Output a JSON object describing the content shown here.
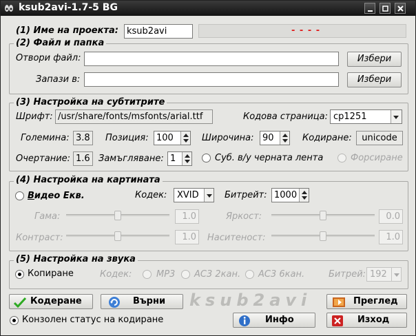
{
  "window": {
    "title": "ksub2avi-1.7-5 BG"
  },
  "project": {
    "label": "(1) Име на проекта:",
    "value": "ksub2avi",
    "status": "- - - -"
  },
  "files": {
    "legend": "(2) Файл и папка",
    "open_label": "Отвори файл:",
    "open_value": "",
    "open_button": "Избери",
    "save_label": "Запази в:",
    "save_value": "",
    "save_button": "Избери"
  },
  "subs": {
    "legend": "(3) Настройка на субтитрите",
    "font_label": "Шрифт:",
    "font_value": "/usr/share/fonts/msfonts/arial.ttf",
    "codepage_label": "Кодова страница:",
    "codepage_value": "cp1251",
    "size_label": "Големина:",
    "size_value": "3.8",
    "position_label": "Позиция:",
    "position_value": "100",
    "width_label": "Широчина:",
    "width_value": "90",
    "encoding_label": "Кодиране:",
    "encoding_value": "unicode",
    "outline_label": "Очертание:",
    "outline_value": "1.6",
    "blur_label": "Замъгляване:",
    "blur_value": "1",
    "blackbar_label": "Суб. в/у черната лента",
    "force_label": "Форсиране"
  },
  "video": {
    "legend": "(4) Настройка на картината",
    "equiv_label_u": "В",
    "equiv_label_rest": "идео Екв.",
    "codec_label": "Кодек:",
    "codec_value": "XVID",
    "bitrate_label": "Битрейт:",
    "bitrate_value": "1000",
    "gamma_label": "Гама:",
    "gamma_value": "1.0",
    "gamma_level": 0.5,
    "brightness_label": "Яркост:",
    "brightness_value": "0.0",
    "brightness_level": 0.5,
    "contrast_label": "Контраст:",
    "contrast_value": "1.0",
    "contrast_level": 0.5,
    "saturation_label": "Наситеност:",
    "saturation_value": "1.0",
    "saturation_level": 0.5
  },
  "audio": {
    "legend": "(5) Настройка на звука",
    "copy_label": "Копиране",
    "codec_label": "Кодек:",
    "mp3_label": "MP3",
    "ac3_2_label": "AC3 2кан.",
    "ac3_6_label": "AC3 6кан.",
    "bitrate_label": "Битрей:",
    "bitrate_value": "192"
  },
  "bottom": {
    "encode_button": "Кодеране",
    "back_button": "Върни",
    "brand": "ksub2avi",
    "preview_button": "Преглед",
    "console_label": "Конзолен статус на кодиране",
    "info_button": "Инфо",
    "exit_button": "Изход"
  },
  "colors": {
    "status_red": "#e02020",
    "check_green": "#2eaa22",
    "exit_red": "#cc2222"
  }
}
